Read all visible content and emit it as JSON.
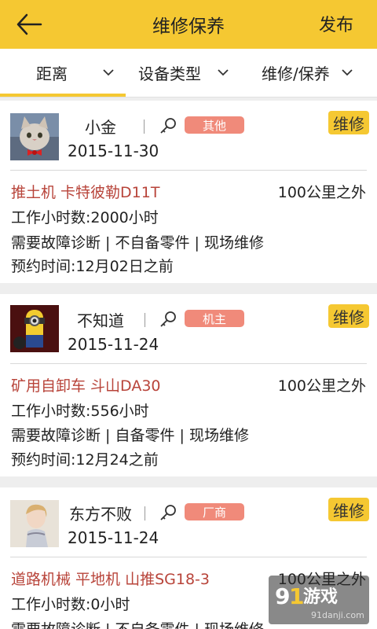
{
  "header": {
    "title": "维修保养",
    "publish_label": "发布",
    "back_icon": "back-arrow-icon"
  },
  "filters": [
    {
      "label": "距离"
    },
    {
      "label": "设备类型"
    },
    {
      "label": "维修/保养"
    }
  ],
  "colors": {
    "accent": "#f5c832",
    "role_tag": "#f08a7a",
    "title_red": "#b8443a"
  },
  "cards": [
    {
      "username": "小金",
      "role": "其他",
      "type": "维修",
      "date": "2015-11-30",
      "equipment": "推土机 卡特彼勒D11T",
      "distance": "100公里之外",
      "hours": "工作小时数:2000小时",
      "services": "需要故障诊断 | 不自备零件 | 现场维修",
      "appointment": "预约时间:12月02日之前"
    },
    {
      "username": "不知道",
      "role": "机主",
      "type": "维修",
      "date": "2015-11-24",
      "equipment": "矿用自卸车 斗山DA30",
      "distance": "100公里之外",
      "hours": "工作小时数:556小时",
      "services": "需要故障诊断 | 自备零件 | 现场维修",
      "appointment": "预约时间:12月24之前"
    },
    {
      "username": "东方不败",
      "role": "厂商",
      "type": "维修",
      "date": "2015-11-24",
      "equipment": "道路机械 平地机 山推SG18-3",
      "distance": "100公里之外",
      "hours": "工作小时数:0小时",
      "services": "需要故障诊断 | 不自备零件 | 现场维修",
      "appointment": ""
    }
  ],
  "watermark": {
    "brand": "91游戏",
    "site": "91danji.com"
  }
}
